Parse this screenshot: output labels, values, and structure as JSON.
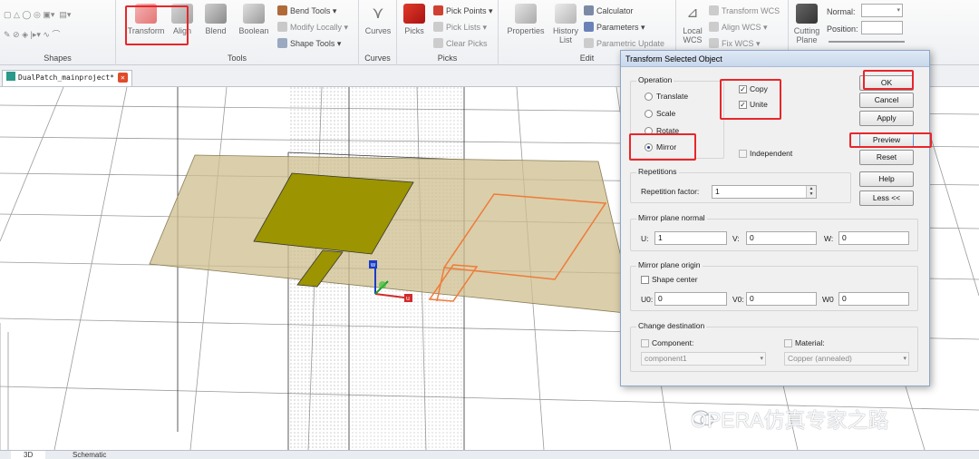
{
  "ribbon": {
    "groups": [
      {
        "label": "Shapes"
      },
      {
        "label": "Tools"
      },
      {
        "label": "Curves"
      },
      {
        "label": "Picks"
      },
      {
        "label": "Edit"
      }
    ],
    "tools": {
      "transform": "Transform",
      "align": "Align",
      "blend": "Blend",
      "boolean": "Boolean",
      "bend_tools": "Bend Tools",
      "modify_locally": "Modify Locally",
      "shape_tools": "Shape Tools"
    },
    "curves": {
      "label": "Curves"
    },
    "picks": {
      "label": "Picks",
      "pick_points": "Pick Points",
      "pick_lists": "Pick Lists",
      "clear_picks": "Clear Picks"
    },
    "edit": {
      "properties": "Properties",
      "history": "History",
      "history2": "List",
      "calculator": "Calculator",
      "parameters": "Parameters",
      "parametric_update": "Parametric Update"
    },
    "wcs": {
      "local": "Local",
      "local2": "WCS",
      "transform_wcs": "Transform WCS",
      "align_wcs": "Align WCS",
      "fix_wcs": "Fix WCS"
    },
    "cutting": {
      "label": "Cutting",
      "label2": "Plane",
      "normal": "Normal:",
      "position": "Position:"
    }
  },
  "doc_tab": {
    "label": "DualPatch_mainproject*"
  },
  "viewport": {
    "axis_u": "u",
    "axis_w": "w"
  },
  "bottom_tabs": [
    "3D",
    "Schematic"
  ],
  "dialog": {
    "title": "Transform Selected Object",
    "operation": {
      "legend": "Operation",
      "options": [
        "Translate",
        "Scale",
        "Rotate",
        "Mirror"
      ],
      "selected": "Mirror",
      "copy": "Copy",
      "unite": "Unite",
      "independent": "Independent"
    },
    "repetitions": {
      "legend": "Repetitions",
      "factor_label": "Repetition factor:",
      "factor_value": "1"
    },
    "mirror_normal": {
      "legend": "Mirror plane normal",
      "u_label": "U:",
      "u_value": "1",
      "v_label": "V:",
      "v_value": "0",
      "w_label": "W:",
      "w_value": "0"
    },
    "mirror_origin": {
      "legend": "Mirror plane origin",
      "shape_center": "Shape center",
      "u0_label": "U0:",
      "u0_value": "0",
      "v0_label": "V0:",
      "v0_value": "0",
      "w0_label": "W0",
      "w0_value": "0"
    },
    "change_destination": {
      "legend": "Change destination",
      "component_label": "Component:",
      "component_value": "component1",
      "material_label": "Material:",
      "material_value": "Copper (annealed)"
    },
    "buttons": {
      "ok": "OK",
      "cancel": "Cancel",
      "apply": "Apply",
      "preview": "Preview",
      "reset": "Reset",
      "help": "Help",
      "less": "Less <<"
    }
  },
  "watermark": "OPERA仿真专家之路",
  "colors": {
    "highlight": "#e8262a",
    "patch": "#9c9400",
    "substrate": "#cdbf8e",
    "mirror_outline": "#f07a3a"
  }
}
